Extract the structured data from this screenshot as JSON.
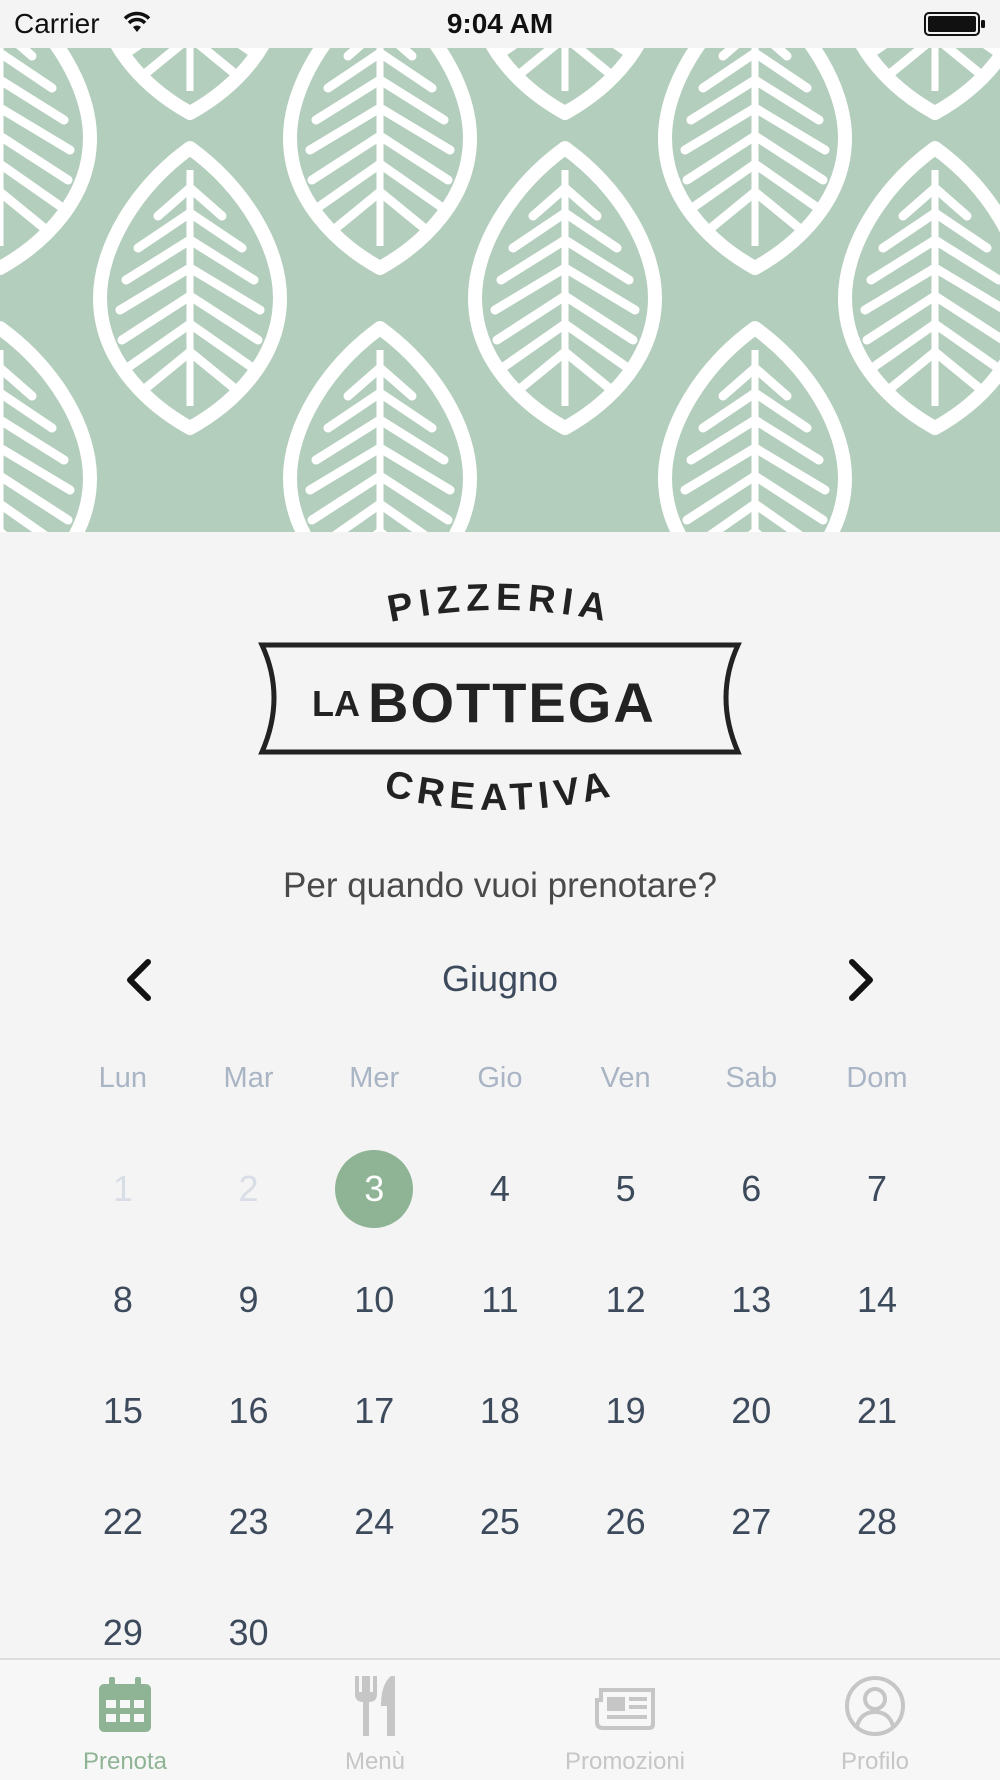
{
  "status_bar": {
    "carrier": "Carrier",
    "time": "9:04 AM"
  },
  "logo": {
    "top": "PIZZERIA",
    "middle_small": "LA",
    "middle_big": "BOTTEGA",
    "bottom": "CREATIVA"
  },
  "question": "Per quando vuoi prenotare?",
  "calendar": {
    "month": "Giugno",
    "weekdays": [
      "Lun",
      "Mar",
      "Mer",
      "Gio",
      "Ven",
      "Sab",
      "Dom"
    ],
    "days": [
      "1",
      "2",
      "3",
      "4",
      "5",
      "6",
      "7",
      "8",
      "9",
      "10",
      "11",
      "12",
      "13",
      "14",
      "15",
      "16",
      "17",
      "18",
      "19",
      "20",
      "21",
      "22",
      "23",
      "24",
      "25",
      "26",
      "27",
      "28",
      "29",
      "30"
    ],
    "selected_day": "3",
    "disabled_days": [
      "1",
      "2"
    ]
  },
  "tabs": [
    {
      "label": "Prenota",
      "icon": "calendar-icon",
      "active": true
    },
    {
      "label": "Menù",
      "icon": "fork-knife-icon",
      "active": false
    },
    {
      "label": "Promozioni",
      "icon": "newspaper-icon",
      "active": false
    },
    {
      "label": "Profilo",
      "icon": "profile-icon",
      "active": false
    }
  ],
  "colors": {
    "accent": "#8fb495",
    "hero_bg": "#b4cebd",
    "text": "#3d4a5c",
    "inactive": "#c6c6c6"
  }
}
